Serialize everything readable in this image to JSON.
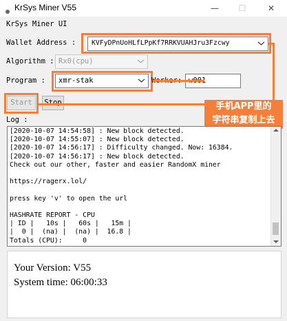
{
  "window": {
    "title": "KrSys Miner V55",
    "controls": {
      "minimize": "—",
      "maximize": "☐",
      "close": "✕"
    }
  },
  "app": {
    "header": "KrSys Miner UI"
  },
  "form": {
    "wallet_label": "Wallet Address :",
    "wallet_value": "KVFyDPnUoHLfLPpKf7RRKVUAHJru3Fzcwy",
    "algorithm_label": "Algorithm :",
    "algorithm_value": "Rx0(cpu)",
    "program_label": "Program :",
    "program_value": "xmr-stak",
    "worker_label": "Worker:",
    "worker_value": "w001"
  },
  "buttons": {
    "start": "Start",
    "stop": "Stop"
  },
  "log": {
    "label": "Log :",
    "lines": [
      "[2020-10-07 14:54:58] : New block detected.",
      "[2020-10-07 14:55:07] : New block detected.",
      "[2020-10-07 14:56:17] : Difficulty changed. Now: 16384.",
      "[2020-10-07 14:56:17] : New block detected.",
      "Check out our other, faster and easier RandomX miner",
      "",
      "https://ragerx.lol/",
      "",
      "press key 'v' to open the url",
      "",
      "HASHRATE REPORT - CPU",
      "| ID |   10s |   60s |   15m |",
      "|  0 |  (na) |  (na) |  16.8 |",
      "Totals (CPU):     0"
    ]
  },
  "annotation": {
    "callout_text": "手机APP里的\n字符串复制上去"
  },
  "status": {
    "version": "Your Version: V55",
    "system_time": "System time: 06:00:33"
  }
}
